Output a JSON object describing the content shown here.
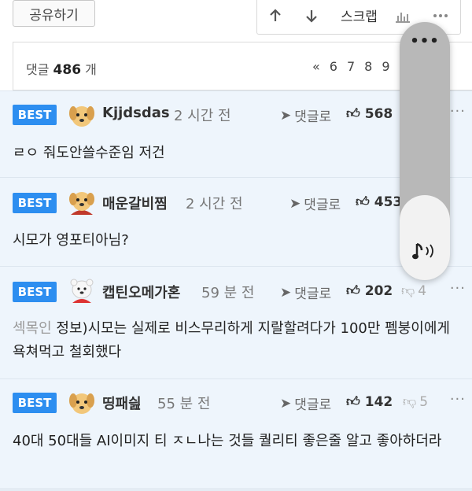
{
  "top": {
    "share_label": "공유하기",
    "scrap_label": "스크랩"
  },
  "comments_header": {
    "label": "댓글",
    "count": "486",
    "unit": "개",
    "pager_prev": "«",
    "pages": [
      "6",
      "7",
      "8",
      "9"
    ]
  },
  "comments": [
    {
      "badge": "BEST",
      "nick": "Kjjdsdas",
      "time": "2 시간 전",
      "reply_label": "댓글로",
      "likes": "568",
      "dislikes": "",
      "body": "ㄹㅇ 줘도안쓸수준임 저건",
      "source": ""
    },
    {
      "badge": "BEST",
      "nick": "매운갈비찜",
      "time": "2 시간 전",
      "reply_label": "댓글로",
      "likes": "453",
      "dislikes": "",
      "body": "시모가 영포티아님?",
      "source": ""
    },
    {
      "badge": "BEST",
      "nick": "캡틴오메가혼",
      "time": "59 분 전",
      "reply_label": "댓글로",
      "likes": "202",
      "dislikes": "4",
      "body": "정보)시모는 실제로 비스무리하게 지랄할려다가 100만 펨붕이에게 욕쳐먹고 철회했다",
      "source": "섹목인"
    },
    {
      "badge": "BEST",
      "nick": "띵패싎",
      "time": "55 분 전",
      "reply_label": "댓글로",
      "likes": "142",
      "dislikes": "5",
      "body": "40대 50대들 AI이미지 티 ㅈㄴ나는 것들 퀄리티 좋은줄 알고 좋아하더라",
      "source": ""
    }
  ],
  "volume_panel": {
    "menu_glyph": "•••",
    "level": 0.33
  },
  "colors": {
    "best_badge": "#2d8ef0",
    "comment_bg": "#eef5fc"
  }
}
